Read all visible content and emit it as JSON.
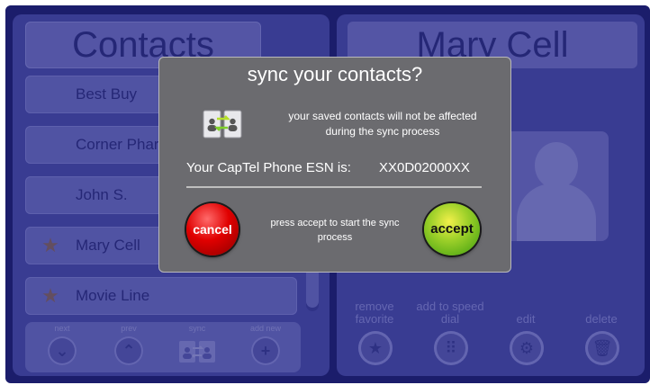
{
  "contacts_panel": {
    "title": "Contacts",
    "items": [
      {
        "label": "Best Buy",
        "favorite": false
      },
      {
        "label": "Corner Pharmacy",
        "favorite": false
      },
      {
        "label": "John S.",
        "favorite": false
      },
      {
        "label": "Mary Cell",
        "favorite": true
      },
      {
        "label": "Movie Line",
        "favorite": true
      }
    ],
    "nav": {
      "next_label": "next",
      "prev_label": "prev",
      "sync_label": "sync",
      "add_new_label": "add new"
    }
  },
  "detail_panel": {
    "title": "Mary Cell",
    "actions": {
      "remove_favorite_label": "remove favorite",
      "speed_dial_label": "add to speed dial",
      "edit_label": "edit",
      "delete_label": "delete"
    }
  },
  "dialog": {
    "title": "sync your contacts?",
    "message": "your saved contacts will not be affected during the sync process",
    "esn_label": "Your CapTel Phone ESN is:",
    "esn_value": "XX0D02000XX",
    "cancel_label": "cancel",
    "accept_label": "accept",
    "accept_hint": "press accept to start the sync process"
  },
  "colors": {
    "background": "#1c1f6b",
    "panel": "#4b4fa6",
    "dialog": "#6b6b6f",
    "cancel": "#e00000",
    "accept": "#9fd12a"
  }
}
